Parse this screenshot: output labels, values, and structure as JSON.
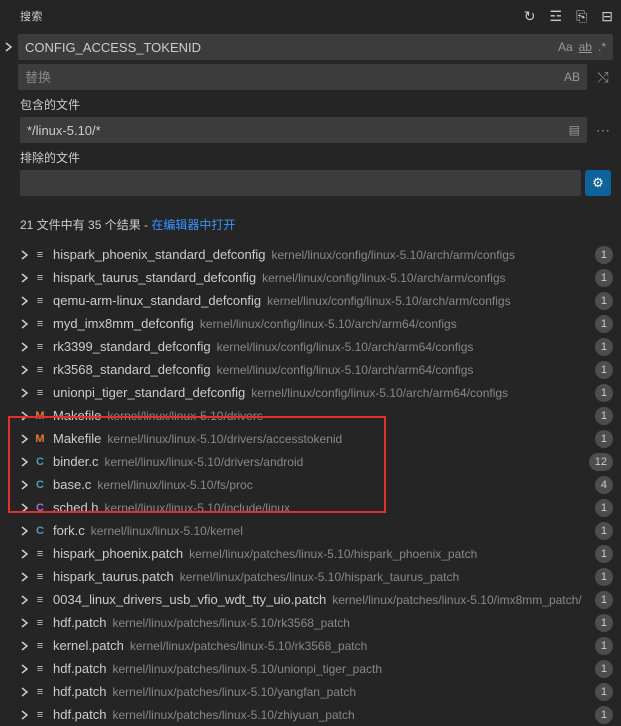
{
  "header": {
    "title": "搜索"
  },
  "search": {
    "value": "CONFIG_ACCESS_TOKENID",
    "caseLabel": "Aa",
    "wholeWordLabel": "ab",
    "regexLabel": ".*"
  },
  "replace": {
    "placeholder": "替换",
    "abLabel": "AB"
  },
  "includeLabel": "包含的文件",
  "include": {
    "value": "*/linux-5.10/*"
  },
  "excludeLabel": "排除的文件",
  "summary": {
    "text": "21 文件中有 35 个结果 - ",
    "link": "在编辑器中打开"
  },
  "results": [
    {
      "icon": "config",
      "iconText": "≡",
      "name": "hispark_phoenix_standard_defconfig",
      "path": "kernel/linux/config/linux-5.10/arch/arm/configs",
      "count": 1,
      "highlighted": false
    },
    {
      "icon": "config",
      "iconText": "≡",
      "name": "hispark_taurus_standard_defconfig",
      "path": "kernel/linux/config/linux-5.10/arch/arm/configs",
      "count": 1,
      "highlighted": false
    },
    {
      "icon": "config",
      "iconText": "≡",
      "name": "qemu-arm-linux_standard_defconfig",
      "path": "kernel/linux/config/linux-5.10/arch/arm/configs",
      "count": 1,
      "highlighted": false
    },
    {
      "icon": "config",
      "iconText": "≡",
      "name": "myd_imx8mm_defconfig",
      "path": "kernel/linux/config/linux-5.10/arch/arm64/configs",
      "count": 1,
      "highlighted": false
    },
    {
      "icon": "config",
      "iconText": "≡",
      "name": "rk3399_standard_defconfig",
      "path": "kernel/linux/config/linux-5.10/arch/arm64/configs",
      "count": 1,
      "highlighted": false
    },
    {
      "icon": "config",
      "iconText": "≡",
      "name": "rk3568_standard_defconfig",
      "path": "kernel/linux/config/linux-5.10/arch/arm64/configs",
      "count": 1,
      "highlighted": false
    },
    {
      "icon": "config",
      "iconText": "≡",
      "name": "unionpi_tiger_standard_defconfig",
      "path": "kernel/linux/config/linux-5.10/arch/arm64/configs",
      "count": 1,
      "highlighted": false
    },
    {
      "icon": "makefile",
      "iconText": "M",
      "name": "Makefile",
      "path": "kernel/linux/linux-5.10/drivers",
      "count": 1,
      "highlighted": false
    },
    {
      "icon": "makefile",
      "iconText": "M",
      "name": "Makefile",
      "path": "kernel/linux/linux-5.10/drivers/accesstokenid",
      "count": 1,
      "highlighted": false
    },
    {
      "icon": "c-file",
      "iconText": "C",
      "name": "binder.c",
      "path": "kernel/linux/linux-5.10/drivers/android",
      "count": 12,
      "highlighted": true
    },
    {
      "icon": "c-file",
      "iconText": "C",
      "name": "base.c",
      "path": "kernel/linux/linux-5.10/fs/proc",
      "count": 4,
      "highlighted": true
    },
    {
      "icon": "c-purple",
      "iconText": "C",
      "name": "sched.h",
      "path": "kernel/linux/linux-5.10/include/linux",
      "count": 1,
      "highlighted": true
    },
    {
      "icon": "c-file",
      "iconText": "C",
      "name": "fork.c",
      "path": "kernel/linux/linux-5.10/kernel",
      "count": 1,
      "highlighted": true
    },
    {
      "icon": "patch",
      "iconText": "≡",
      "name": "hispark_phoenix.patch",
      "path": "kernel/linux/patches/linux-5.10/hispark_phoenix_patch",
      "count": 1,
      "highlighted": false
    },
    {
      "icon": "patch",
      "iconText": "≡",
      "name": "hispark_taurus.patch",
      "path": "kernel/linux/patches/linux-5.10/hispark_taurus_patch",
      "count": 1,
      "highlighted": false
    },
    {
      "icon": "patch",
      "iconText": "≡",
      "name": "0034_linux_drivers_usb_vfio_wdt_tty_uio.patch",
      "path": "kernel/linux/patches/linux-5.10/imx8mm_patch/",
      "count": 1,
      "highlighted": false
    },
    {
      "icon": "patch",
      "iconText": "≡",
      "name": "hdf.patch",
      "path": "kernel/linux/patches/linux-5.10/rk3568_patch",
      "count": 1,
      "highlighted": false
    },
    {
      "icon": "patch",
      "iconText": "≡",
      "name": "kernel.patch",
      "path": "kernel/linux/patches/linux-5.10/rk3568_patch",
      "count": 1,
      "highlighted": false
    },
    {
      "icon": "patch",
      "iconText": "≡",
      "name": "hdf.patch",
      "path": "kernel/linux/patches/linux-5.10/unionpi_tiger_pacth",
      "count": 1,
      "highlighted": false
    },
    {
      "icon": "patch",
      "iconText": "≡",
      "name": "hdf.patch",
      "path": "kernel/linux/patches/linux-5.10/yangfan_patch",
      "count": 1,
      "highlighted": false
    },
    {
      "icon": "patch",
      "iconText": "≡",
      "name": "hdf.patch",
      "path": "kernel/linux/patches/linux-5.10/zhiyuan_patch",
      "count": 1,
      "highlighted": false
    }
  ]
}
